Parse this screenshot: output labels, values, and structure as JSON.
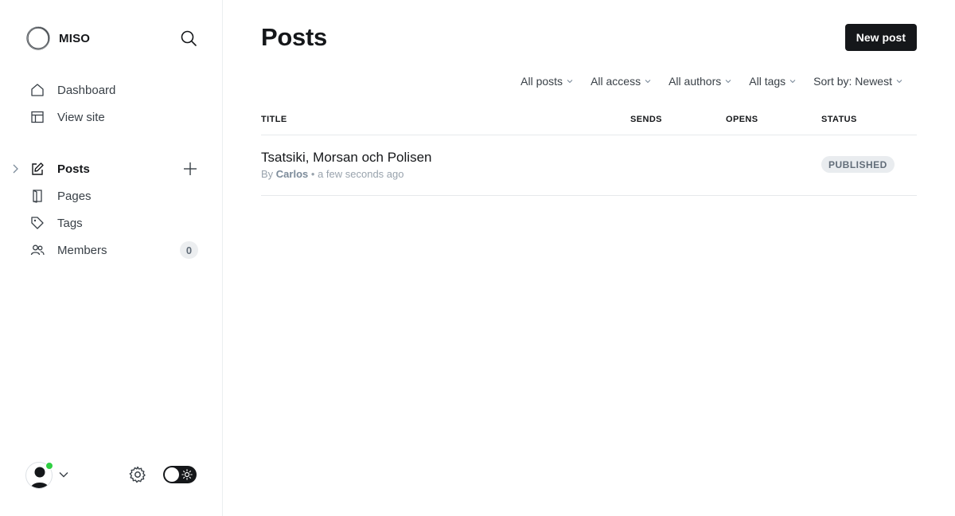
{
  "brand": {
    "name": "MISO",
    "logo_icon": "miso-ring-logo"
  },
  "sidebar": {
    "top_items": [
      {
        "label": "Dashboard",
        "icon": "home-icon"
      },
      {
        "label": "View site",
        "icon": "layout-icon"
      }
    ],
    "main_items": [
      {
        "label": "Posts",
        "icon": "edit-icon",
        "active": true
      },
      {
        "label": "Pages",
        "icon": "page-icon"
      },
      {
        "label": "Tags",
        "icon": "tag-icon"
      },
      {
        "label": "Members",
        "icon": "members-icon",
        "count": "0"
      }
    ]
  },
  "main": {
    "title": "Posts",
    "new_post_label": "New post",
    "filters": [
      "All posts",
      "All access",
      "All authors",
      "All tags",
      "Sort by: Newest"
    ],
    "columns": {
      "title": "TITLE",
      "sends": "SENDS",
      "opens": "OPENS",
      "status": "STATUS"
    },
    "posts": [
      {
        "title": "Tsatsiki, Morsan och Polisen",
        "by": "By",
        "author": "Carlos",
        "separator": "•",
        "time": "a few seconds ago",
        "status": "PUBLISHED"
      }
    ]
  },
  "colors": {
    "accent_dark": "#15171a",
    "online": "#30cf43",
    "muted_text": "#99a3ad",
    "badge_bg": "#e9ecef"
  }
}
